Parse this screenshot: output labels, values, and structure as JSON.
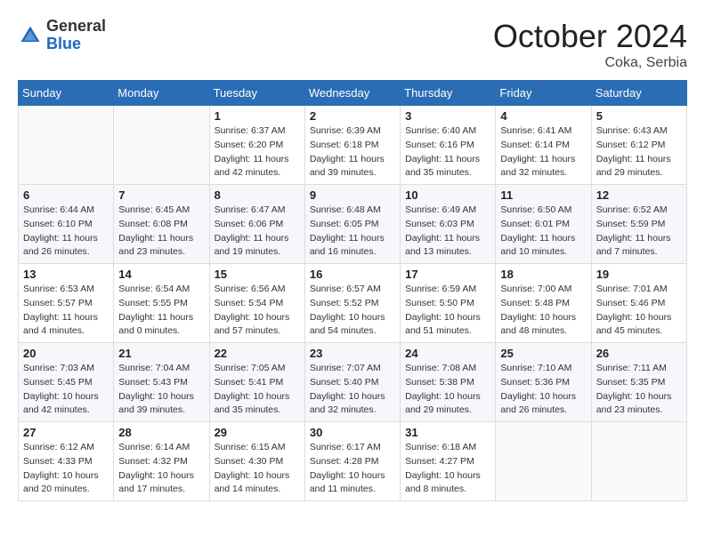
{
  "logo": {
    "general": "General",
    "blue": "Blue"
  },
  "title": "October 2024",
  "location": "Coka, Serbia",
  "days_of_week": [
    "Sunday",
    "Monday",
    "Tuesday",
    "Wednesday",
    "Thursday",
    "Friday",
    "Saturday"
  ],
  "weeks": [
    [
      {
        "day": "",
        "info": ""
      },
      {
        "day": "",
        "info": ""
      },
      {
        "day": "1",
        "info": "Sunrise: 6:37 AM\nSunset: 6:20 PM\nDaylight: 11 hours and 42 minutes."
      },
      {
        "day": "2",
        "info": "Sunrise: 6:39 AM\nSunset: 6:18 PM\nDaylight: 11 hours and 39 minutes."
      },
      {
        "day": "3",
        "info": "Sunrise: 6:40 AM\nSunset: 6:16 PM\nDaylight: 11 hours and 35 minutes."
      },
      {
        "day": "4",
        "info": "Sunrise: 6:41 AM\nSunset: 6:14 PM\nDaylight: 11 hours and 32 minutes."
      },
      {
        "day": "5",
        "info": "Sunrise: 6:43 AM\nSunset: 6:12 PM\nDaylight: 11 hours and 29 minutes."
      }
    ],
    [
      {
        "day": "6",
        "info": "Sunrise: 6:44 AM\nSunset: 6:10 PM\nDaylight: 11 hours and 26 minutes."
      },
      {
        "day": "7",
        "info": "Sunrise: 6:45 AM\nSunset: 6:08 PM\nDaylight: 11 hours and 23 minutes."
      },
      {
        "day": "8",
        "info": "Sunrise: 6:47 AM\nSunset: 6:06 PM\nDaylight: 11 hours and 19 minutes."
      },
      {
        "day": "9",
        "info": "Sunrise: 6:48 AM\nSunset: 6:05 PM\nDaylight: 11 hours and 16 minutes."
      },
      {
        "day": "10",
        "info": "Sunrise: 6:49 AM\nSunset: 6:03 PM\nDaylight: 11 hours and 13 minutes."
      },
      {
        "day": "11",
        "info": "Sunrise: 6:50 AM\nSunset: 6:01 PM\nDaylight: 11 hours and 10 minutes."
      },
      {
        "day": "12",
        "info": "Sunrise: 6:52 AM\nSunset: 5:59 PM\nDaylight: 11 hours and 7 minutes."
      }
    ],
    [
      {
        "day": "13",
        "info": "Sunrise: 6:53 AM\nSunset: 5:57 PM\nDaylight: 11 hours and 4 minutes."
      },
      {
        "day": "14",
        "info": "Sunrise: 6:54 AM\nSunset: 5:55 PM\nDaylight: 11 hours and 0 minutes."
      },
      {
        "day": "15",
        "info": "Sunrise: 6:56 AM\nSunset: 5:54 PM\nDaylight: 10 hours and 57 minutes."
      },
      {
        "day": "16",
        "info": "Sunrise: 6:57 AM\nSunset: 5:52 PM\nDaylight: 10 hours and 54 minutes."
      },
      {
        "day": "17",
        "info": "Sunrise: 6:59 AM\nSunset: 5:50 PM\nDaylight: 10 hours and 51 minutes."
      },
      {
        "day": "18",
        "info": "Sunrise: 7:00 AM\nSunset: 5:48 PM\nDaylight: 10 hours and 48 minutes."
      },
      {
        "day": "19",
        "info": "Sunrise: 7:01 AM\nSunset: 5:46 PM\nDaylight: 10 hours and 45 minutes."
      }
    ],
    [
      {
        "day": "20",
        "info": "Sunrise: 7:03 AM\nSunset: 5:45 PM\nDaylight: 10 hours and 42 minutes."
      },
      {
        "day": "21",
        "info": "Sunrise: 7:04 AM\nSunset: 5:43 PM\nDaylight: 10 hours and 39 minutes."
      },
      {
        "day": "22",
        "info": "Sunrise: 7:05 AM\nSunset: 5:41 PM\nDaylight: 10 hours and 35 minutes."
      },
      {
        "day": "23",
        "info": "Sunrise: 7:07 AM\nSunset: 5:40 PM\nDaylight: 10 hours and 32 minutes."
      },
      {
        "day": "24",
        "info": "Sunrise: 7:08 AM\nSunset: 5:38 PM\nDaylight: 10 hours and 29 minutes."
      },
      {
        "day": "25",
        "info": "Sunrise: 7:10 AM\nSunset: 5:36 PM\nDaylight: 10 hours and 26 minutes."
      },
      {
        "day": "26",
        "info": "Sunrise: 7:11 AM\nSunset: 5:35 PM\nDaylight: 10 hours and 23 minutes."
      }
    ],
    [
      {
        "day": "27",
        "info": "Sunrise: 6:12 AM\nSunset: 4:33 PM\nDaylight: 10 hours and 20 minutes."
      },
      {
        "day": "28",
        "info": "Sunrise: 6:14 AM\nSunset: 4:32 PM\nDaylight: 10 hours and 17 minutes."
      },
      {
        "day": "29",
        "info": "Sunrise: 6:15 AM\nSunset: 4:30 PM\nDaylight: 10 hours and 14 minutes."
      },
      {
        "day": "30",
        "info": "Sunrise: 6:17 AM\nSunset: 4:28 PM\nDaylight: 10 hours and 11 minutes."
      },
      {
        "day": "31",
        "info": "Sunrise: 6:18 AM\nSunset: 4:27 PM\nDaylight: 10 hours and 8 minutes."
      },
      {
        "day": "",
        "info": ""
      },
      {
        "day": "",
        "info": ""
      }
    ]
  ]
}
